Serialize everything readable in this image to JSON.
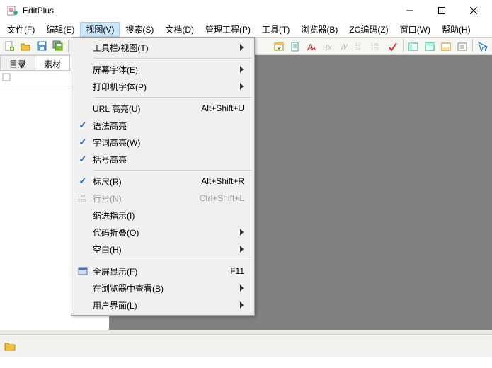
{
  "title": "EditPlus",
  "menubar": [
    "文件(F)",
    "编辑(E)",
    "视图(V)",
    "搜索(S)",
    "文档(D)",
    "管理工程(P)",
    "工具(T)",
    "浏览器(B)",
    "ZC编码(Z)",
    "窗口(W)",
    "帮助(H)"
  ],
  "active_menu_index": 2,
  "tabs": {
    "directory": "目录",
    "material": "素材"
  },
  "dropdown": {
    "items": [
      {
        "label": "工具栏/视图(T)",
        "submenu": true
      },
      {
        "divider": true
      },
      {
        "label": "屏幕字体(E)",
        "submenu": true
      },
      {
        "label": "打印机字体(P)",
        "submenu": true
      },
      {
        "divider": true
      },
      {
        "label": "URL 高亮(U)",
        "shortcut": "Alt+Shift+U"
      },
      {
        "label": "语法高亮",
        "checked": true
      },
      {
        "label": "字词高亮(W)",
        "checked": true
      },
      {
        "label": "括号高亮",
        "checked": true
      },
      {
        "divider": true
      },
      {
        "label": "标尺(R)",
        "shortcut": "Alt+Shift+R",
        "checked": true
      },
      {
        "label": "行号(N)",
        "shortcut": "Ctrl+Shift+L",
        "disabled": true,
        "icon": "linenum"
      },
      {
        "label": "缩进指示(I)"
      },
      {
        "label": "代码折叠(O)",
        "submenu": true
      },
      {
        "label": "空白(H)",
        "submenu": true
      },
      {
        "divider": true
      },
      {
        "label": "全屏显示(F)",
        "shortcut": "F11",
        "icon": "fullscreen"
      },
      {
        "label": "在浏览器中查看(B)",
        "submenu": true
      },
      {
        "label": "用户界面(L)",
        "submenu": true
      }
    ]
  }
}
